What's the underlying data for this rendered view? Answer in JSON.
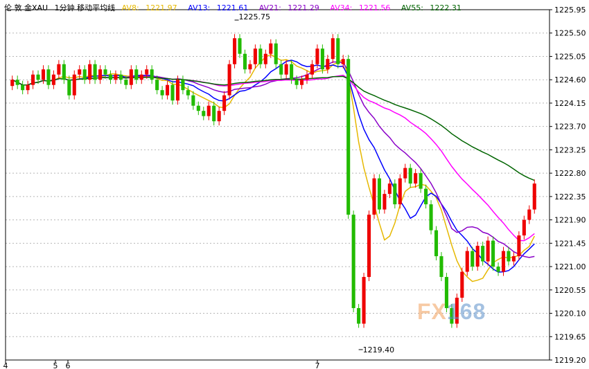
{
  "header": {
    "symbol": "伦 敦 金XAU",
    "period": "1分钟 移动平均线",
    "ma": [
      {
        "label": "AV8:",
        "value": "1221.97",
        "color": "#e6b800"
      },
      {
        "label": "AV13:",
        "value": "1221.61",
        "color": "#0000ff"
      },
      {
        "label": "AV21:",
        "value": "1221.29",
        "color": "#8a00c8"
      },
      {
        "label": "AV34:",
        "value": "1221.56",
        "color": "#ff00ff"
      },
      {
        "label": "AV55:",
        "value": "1222.31",
        "color": "#006400"
      }
    ]
  },
  "watermark": {
    "left": "FX",
    "right": "168"
  },
  "colors": {
    "up": "#ee0000",
    "down": "#22bb00",
    "grid": "#b5b5b5",
    "axis": "#000000"
  },
  "chart_data": {
    "type": "candlestick",
    "ylim": [
      1219.2,
      1225.95
    ],
    "y_ticks": [
      "1225.95",
      "1225.50",
      "1225.05",
      "1224.60",
      "1224.15",
      "1223.70",
      "1223.25",
      "1222.80",
      "1222.35",
      "1221.90",
      "1221.45",
      "1221.00",
      "1220.55",
      "1220.10",
      "1219.65",
      "1219.20"
    ],
    "x_tick_labels": [
      "4",
      "5",
      "6",
      "7"
    ],
    "annotations": [
      {
        "text": "1225.75",
        "value": 1225.75,
        "type": "high"
      },
      {
        "text": "1219.40",
        "value": 1219.4,
        "type": "low"
      }
    ],
    "closes": [
      1224.6,
      1224.5,
      1224.4,
      1224.5,
      1224.7,
      1224.6,
      1224.8,
      1224.5,
      1224.7,
      1224.9,
      1224.6,
      1224.3,
      1224.7,
      1224.8,
      1224.6,
      1224.9,
      1224.6,
      1224.8,
      1224.7,
      1224.6,
      1224.7,
      1224.6,
      1224.5,
      1224.8,
      1224.6,
      1224.7,
      1224.8,
      1224.6,
      1224.4,
      1224.3,
      1224.5,
      1224.2,
      1224.6,
      1224.4,
      1224.3,
      1224.1,
      1224.0,
      1223.9,
      1224.1,
      1223.8,
      1224.0,
      1224.3,
      1224.9,
      1225.4,
      1225.1,
      1224.8,
      1224.9,
      1225.2,
      1224.9,
      1225.1,
      1225.3,
      1224.9,
      1224.7,
      1224.9,
      1224.6,
      1224.5,
      1224.6,
      1224.7,
      1224.9,
      1225.2,
      1224.8,
      1225.0,
      1225.4,
      1224.9,
      1225.0,
      1222.0,
      1220.2,
      1219.9,
      1220.8,
      1222.0,
      1222.7,
      1222.1,
      1222.4,
      1222.6,
      1222.2,
      1222.7,
      1222.9,
      1222.6,
      1222.8,
      1222.5,
      1222.2,
      1221.7,
      1221.2,
      1220.8,
      1220.2,
      1219.9,
      1220.4,
      1220.9,
      1221.3,
      1221.0,
      1221.4,
      1221.1,
      1221.5,
      1221.0,
      1220.9,
      1221.3,
      1221.1,
      1221.2,
      1221.6,
      1221.9,
      1222.1,
      1222.6
    ]
  }
}
